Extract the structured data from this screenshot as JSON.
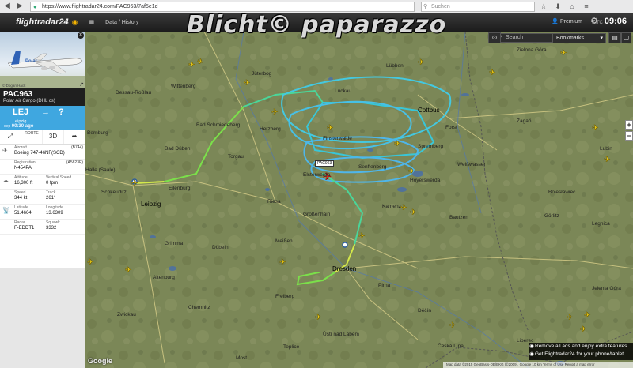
{
  "browser": {
    "url": "https://www.flightradar24.com/PAC963/7af5e1d",
    "search_placeholder": "Suchen",
    "back_icon": "back-arrow-icon",
    "forward_icon": "forward-arrow-icon"
  },
  "watermark": "Blicht© paparazzo",
  "topbar": {
    "logo": "flightradar24",
    "menu": [
      "",
      "Data / History"
    ],
    "premium": "Premium",
    "utc_label": "UTC",
    "time": "09:06"
  },
  "map_controls": {
    "search_placeholder": "Search",
    "bookmarks": "Bookmarks",
    "zoom_in": "+",
    "zoom_out": "−"
  },
  "promo": {
    "line1": "Remove all ads and enjoy extra features",
    "line2": "Get Flightradar24 for your phone/tablet"
  },
  "google_logo": "Google",
  "map_footer": "Map data ©2015 GeoBasis-DE/BKG (©2009), Google  10 km  Terms of Use  Report a map error",
  "flight_label": "PAC963",
  "cities": [
    {
      "name": "Wittenberg",
      "big": false
    },
    {
      "name": "Dessau-Roßlau",
      "big": false
    },
    {
      "name": "Jüterbog",
      "big": false
    },
    {
      "name": "Luckau",
      "big": false
    },
    {
      "name": "Lübben",
      "big": false
    },
    {
      "name": "Cottbus",
      "big": true
    },
    {
      "name": "Forst",
      "big": false
    },
    {
      "name": "Bernburg",
      "big": false
    },
    {
      "name": "Bad Schmiedeberg",
      "big": false
    },
    {
      "name": "Herzberg",
      "big": false
    },
    {
      "name": "Finsterwalde",
      "big": false
    },
    {
      "name": "Senftenberg",
      "big": false
    },
    {
      "name": "Spremberg",
      "big": false
    },
    {
      "name": "Halle (Saale)",
      "big": false
    },
    {
      "name": "Bad Düben",
      "big": false
    },
    {
      "name": "Torgau",
      "big": false
    },
    {
      "name": "Elsterwerda",
      "big": false
    },
    {
      "name": "Hoyerswerda",
      "big": false
    },
    {
      "name": "Weißwasser",
      "big": false
    },
    {
      "name": "Schkeuditz",
      "big": false
    },
    {
      "name": "Eilenburg",
      "big": false
    },
    {
      "name": "Leipzig",
      "big": true
    },
    {
      "name": "Riesa",
      "big": false
    },
    {
      "name": "Großenhain",
      "big": false
    },
    {
      "name": "Kamenz",
      "big": false
    },
    {
      "name": "Bautzen",
      "big": false
    },
    {
      "name": "Görlitz",
      "big": false
    },
    {
      "name": "Grimma",
      "big": false
    },
    {
      "name": "Döbeln",
      "big": false
    },
    {
      "name": "Meißen",
      "big": false
    },
    {
      "name": "Dresden",
      "big": true
    },
    {
      "name": "Altenburg",
      "big": false
    },
    {
      "name": "Freiberg",
      "big": false
    },
    {
      "name": "Pirna",
      "big": false
    },
    {
      "name": "Zwickau",
      "big": false
    },
    {
      "name": "Chemnitz",
      "big": false
    },
    {
      "name": "Děčín",
      "big": false
    },
    {
      "name": "Liberec",
      "big": false
    },
    {
      "name": "Zielona Góra",
      "big": false
    },
    {
      "name": "Žagań",
      "big": false
    },
    {
      "name": "Jelenia Góra",
      "big": false
    },
    {
      "name": "Legnica",
      "big": false
    },
    {
      "name": "Bolesławiec",
      "big": false
    },
    {
      "name": "Ústí nad Labem",
      "big": false
    },
    {
      "name": "Teplice",
      "big": false
    },
    {
      "name": "Most",
      "big": false
    },
    {
      "name": "Česká Lípa",
      "big": false
    },
    {
      "name": "Lubin",
      "big": false
    }
  ],
  "panel": {
    "photo_credit": "© Dogari Hack",
    "callsign": "PAC963",
    "airline": "Polar Air Cargo (DHL cs)",
    "from": "LEJ",
    "to": "?",
    "from_city": "Leipzig",
    "time_prefix": "dep",
    "time_value": "00:30 ago",
    "tools": [
      "",
      "ROUTE",
      "3D",
      ""
    ],
    "aircraft_label": "Aircraft",
    "aircraft_code": "(B744)",
    "aircraft": "Boeing 747-46NF(SCD)",
    "registration_label": "Registration",
    "registration": "N454PA",
    "reg_code": "(A5823E)",
    "altitude_label": "Altitude",
    "altitude": "16,300 ft",
    "vspeed_label": "Vertical Speed",
    "vspeed": "0 fpm",
    "speed_label": "Speed",
    "speed": "344 kt",
    "track_label": "Track",
    "track": "261°",
    "lat_label": "Latitude",
    "lat": "51.4664",
    "lon_label": "Longitude",
    "lon": "13.6309",
    "radar_label": "Radar",
    "radar": "F-EDDT1",
    "squawk_label": "Squawk",
    "squawk": "3332"
  }
}
